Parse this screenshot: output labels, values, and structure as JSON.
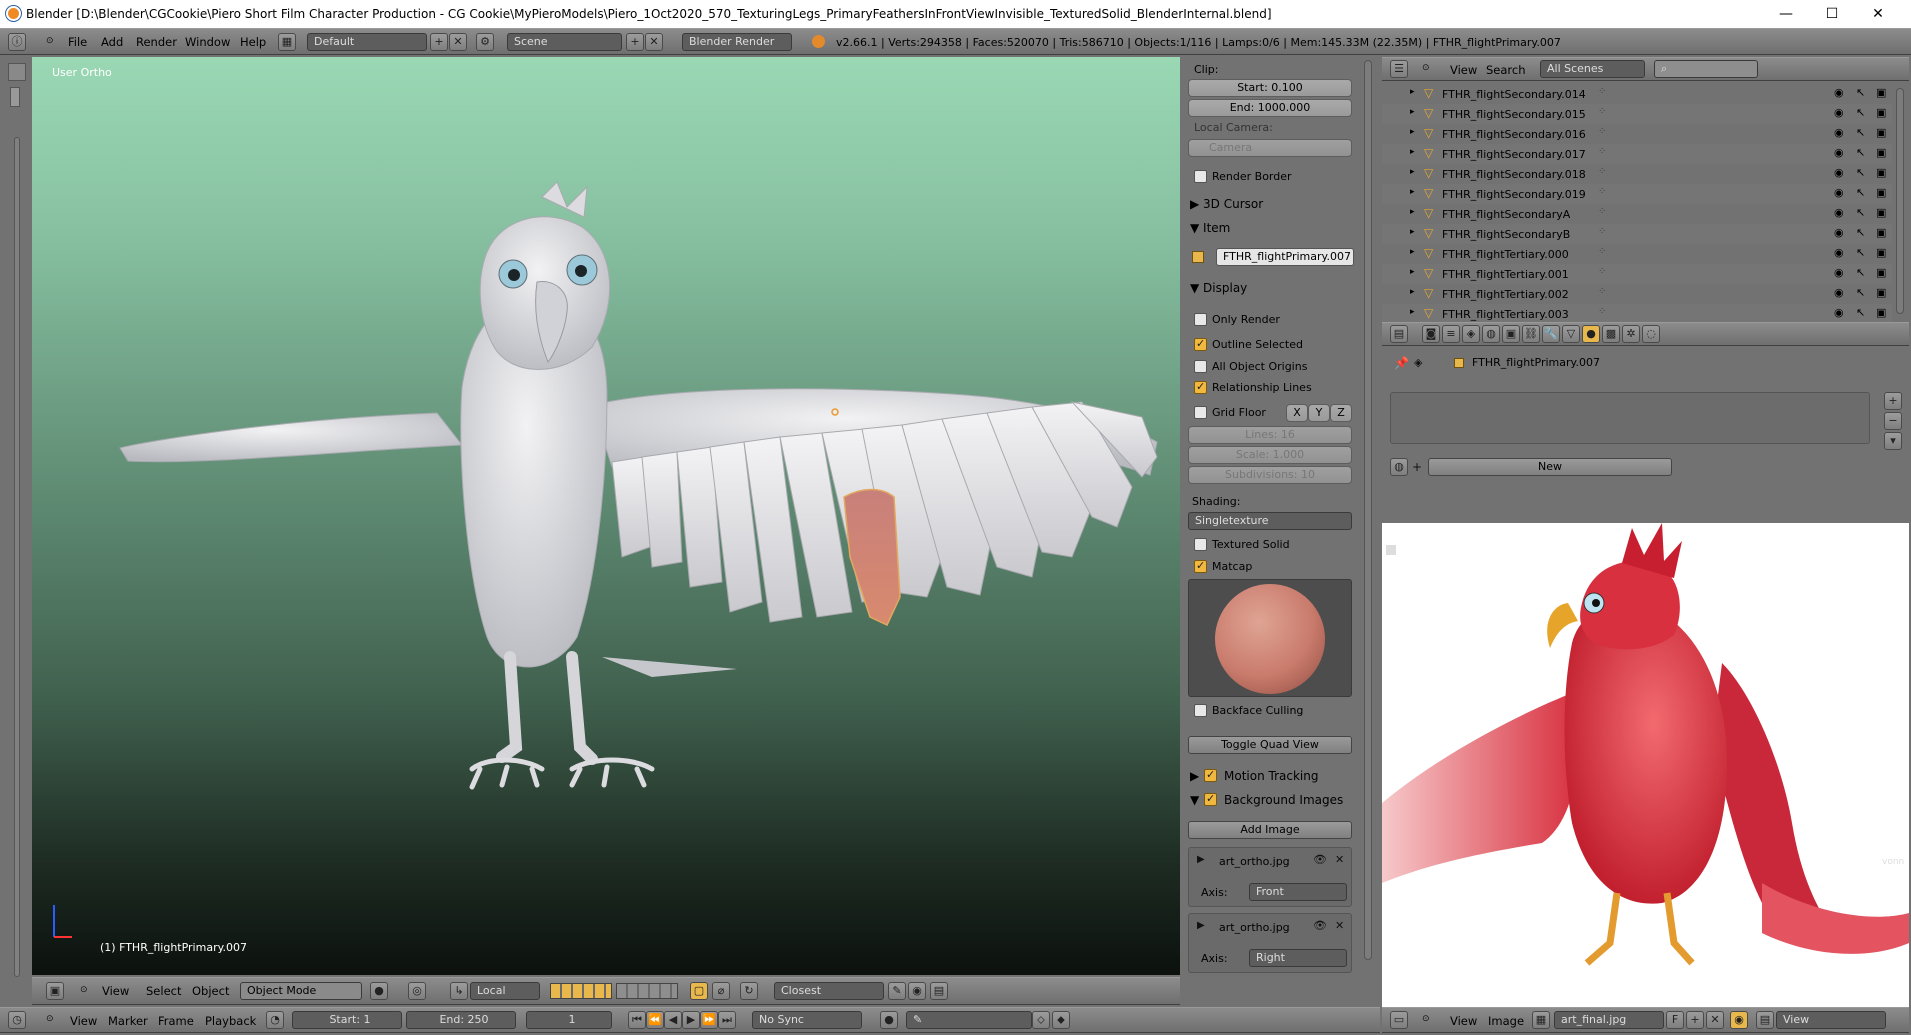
{
  "titlebar": {
    "title": "Blender [D:\\Blender\\CGCookie\\Piero Short Film Character Production - CG Cookie\\MyPieroModels\\Piero_1Oct2020_570_TexturingLegs_PrimaryFeathersInFrontViewInvisible_TexturedSolid_BlenderInternal.blend]",
    "minimize": "—",
    "maximize": "☐",
    "close": "✕"
  },
  "infobar": {
    "menus": [
      "File",
      "Add",
      "Render",
      "Window",
      "Help"
    ],
    "layout": "Default",
    "scene": "Scene",
    "engine": "Blender Render",
    "stats": "v2.66.1 | Verts:294358 | Faces:520070 | Tris:586710 | Objects:1/116 | Lamps:0/6 | Mem:145.33M (22.35M) | FTHR_flightPrimary.007"
  },
  "viewport": {
    "view_label": "User Ortho",
    "object_label": "(1) FTHR_flightPrimary.007"
  },
  "viewport_header": {
    "menus": [
      "View",
      "Select",
      "Object"
    ],
    "mode": "Object Mode",
    "pivot": "Local",
    "snap": "Closest"
  },
  "npanel": {
    "clip_label": "Clip:",
    "clip_start": "Start: 0.100",
    "clip_end": "End: 1000.000",
    "local_camera_label": "Local Camera:",
    "camera_placeholder": "Camera",
    "render_border": "Render Border",
    "cursor_section": "3D Cursor",
    "item_section": "Item",
    "item_name": "FTHR_flightPrimary.007",
    "display_section": "Display",
    "only_render": "Only Render",
    "outline_selected": "Outline Selected",
    "all_object_origins": "All Object Origins",
    "relationship_lines": "Relationship Lines",
    "grid_floor": "Grid Floor",
    "axis_x": "X",
    "axis_y": "Y",
    "axis_z": "Z",
    "lines": "Lines: 16",
    "scale": "Scale: 1.000",
    "subdivisions": "Subdivisions: 10",
    "shading_label": "Shading:",
    "shading_mode": "Singletexture",
    "textured_solid": "Textured Solid",
    "matcap": "Matcap",
    "backface_culling": "Backface Culling",
    "toggle_quad": "Toggle Quad View",
    "motion_tracking": "Motion Tracking",
    "background_images": "Background Images",
    "add_image": "Add Image",
    "bg1_name": "art_ortho.jpg",
    "bg1_axis_label": "Axis:",
    "bg1_axis": "Front",
    "bg2_name": "art_ortho.jpg",
    "bg2_axis_label": "Axis:",
    "bg2_axis": "Right"
  },
  "outliner": {
    "menus": [
      "View",
      "Search"
    ],
    "filter": "All Scenes",
    "rows": [
      "FTHR_flightSecondary.014",
      "FTHR_flightSecondary.015",
      "FTHR_flightSecondary.016",
      "FTHR_flightSecondary.017",
      "FTHR_flightSecondary.018",
      "FTHR_flightSecondary.019",
      "FTHR_flightSecondaryA",
      "FTHR_flightSecondaryB",
      "FTHR_flightTertiary.000",
      "FTHR_flightTertiary.001",
      "FTHR_flightTertiary.002",
      "FTHR_flightTertiary.003"
    ]
  },
  "properties": {
    "breadcrumb": "FTHR_flightPrimary.007",
    "new_button": "New"
  },
  "image_editor": {
    "watermark": "vonn",
    "menus": [
      "View",
      "Image"
    ],
    "image_name": "art_final.jpg",
    "fake_user": "F",
    "view": "View"
  },
  "timeline": {
    "menus": [
      "View",
      "Marker",
      "Frame",
      "Playback"
    ],
    "start": "Start: 1",
    "end": "End: 250",
    "frame": "1",
    "sync": "No Sync"
  },
  "colors": {
    "matcap": "#c97b6c",
    "selected_feather": "#d88a6e",
    "bird_red": "#d8303f",
    "bg_green_top": "#9ad8b4"
  }
}
